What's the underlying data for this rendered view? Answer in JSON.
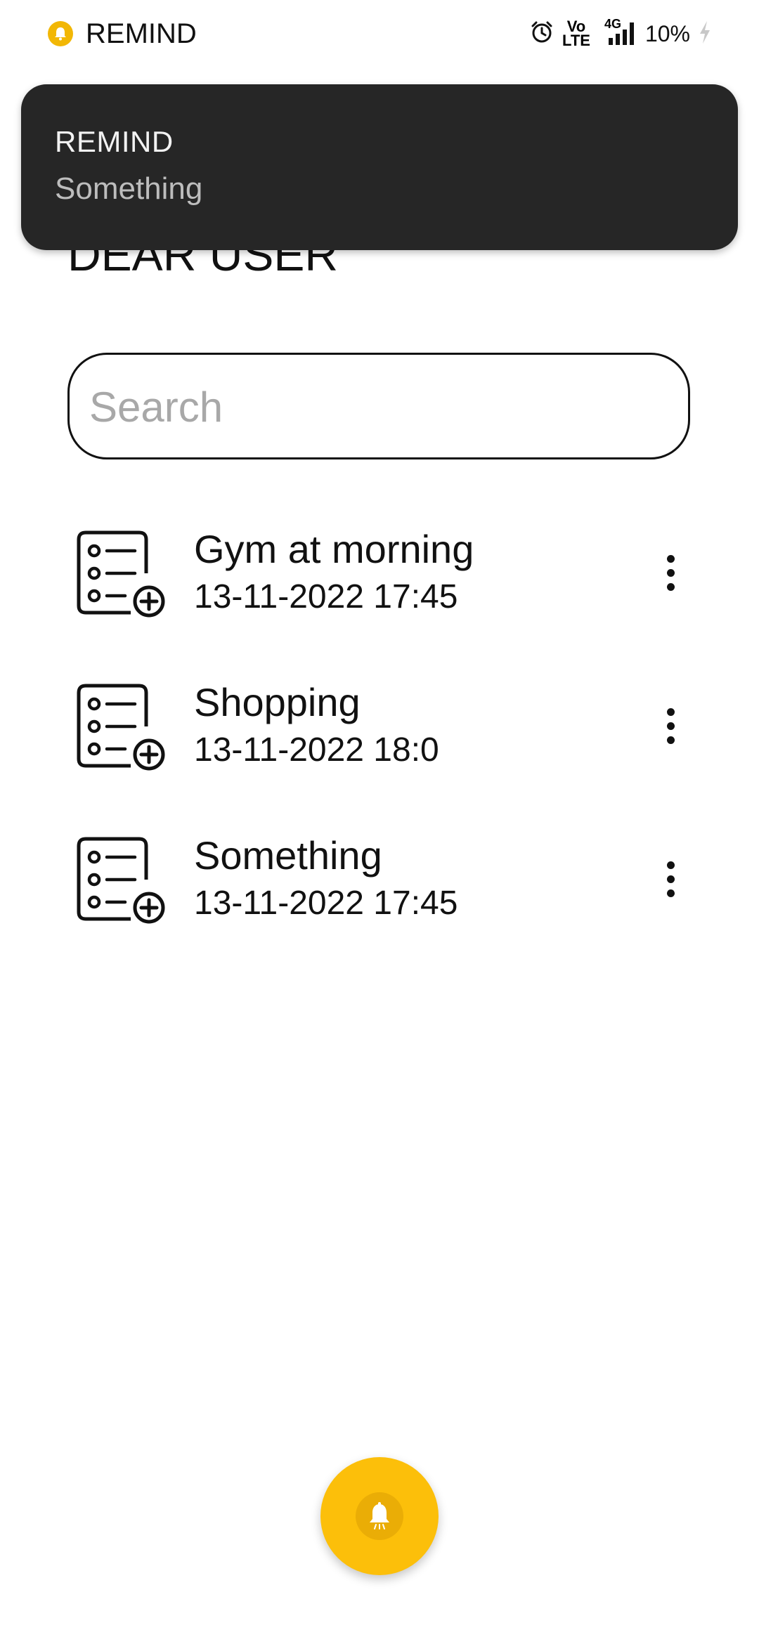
{
  "status_bar": {
    "app_name": "REMIND",
    "network_top": "Vo",
    "network_bottom": "LTE",
    "signal_label": "4G",
    "battery": "10%",
    "icons": [
      "notification-bell-icon",
      "alarm-icon",
      "volte-icon",
      "signal-icon",
      "battery-charging-icon"
    ]
  },
  "notification": {
    "title": "REMIND",
    "body": "Something"
  },
  "greeting": "DEAR USER",
  "search": {
    "placeholder": "Search",
    "value": ""
  },
  "reminders": [
    {
      "title": "Gym at morning",
      "datetime": "13-11-2022 17:45",
      "icon": "checklist-add-icon"
    },
    {
      "title": "Shopping",
      "datetime": "13-11-2022 18:0",
      "icon": "checklist-add-icon"
    },
    {
      "title": "Something",
      "datetime": "13-11-2022 17:45",
      "icon": "checklist-add-icon"
    }
  ],
  "fab": {
    "icon": "bell-icon"
  },
  "colors": {
    "accent": "#fcbf0a",
    "notification_bg": "#262626",
    "text": "#111111",
    "placeholder": "#a8a8a8"
  }
}
